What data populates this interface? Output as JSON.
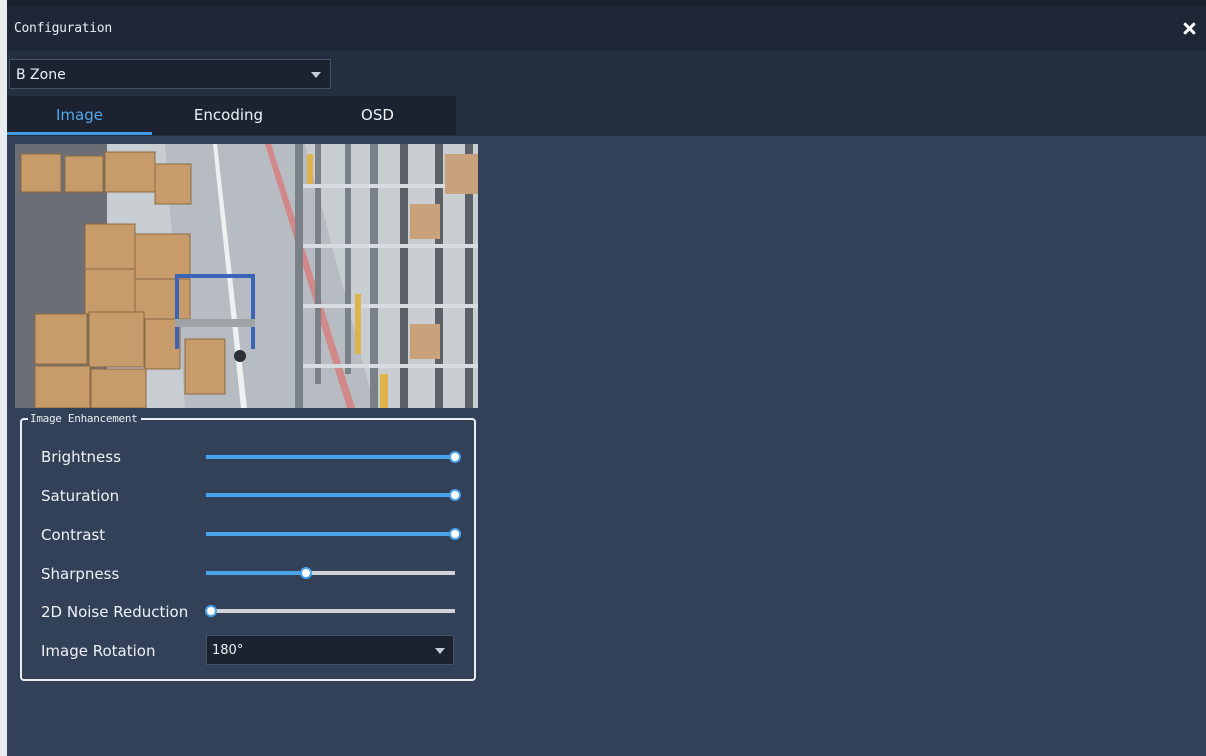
{
  "window": {
    "title": "Configuration",
    "close_icon": "close-icon"
  },
  "zone_select": {
    "value": "B Zone"
  },
  "tabs": [
    {
      "label": "Image",
      "active": true
    },
    {
      "label": "Encoding",
      "active": false
    },
    {
      "label": "OSD",
      "active": false
    }
  ],
  "preview": {
    "description_icon": "camera-preview-image"
  },
  "enhancement": {
    "legend": "Image Enhancement",
    "sliders": [
      {
        "label": "Brightness",
        "value_percent": 100
      },
      {
        "label": "Saturation",
        "value_percent": 100
      },
      {
        "label": "Contrast",
        "value_percent": 100
      },
      {
        "label": "Sharpness",
        "value_percent": 40
      },
      {
        "label": "2D Noise Reduction",
        "value_percent": 0
      }
    ],
    "rotation": {
      "label": "Image Rotation",
      "value": "180°"
    }
  },
  "colors": {
    "accent": "#4aa3ea",
    "panel": "#334158",
    "titlebar": "#1d2736"
  }
}
